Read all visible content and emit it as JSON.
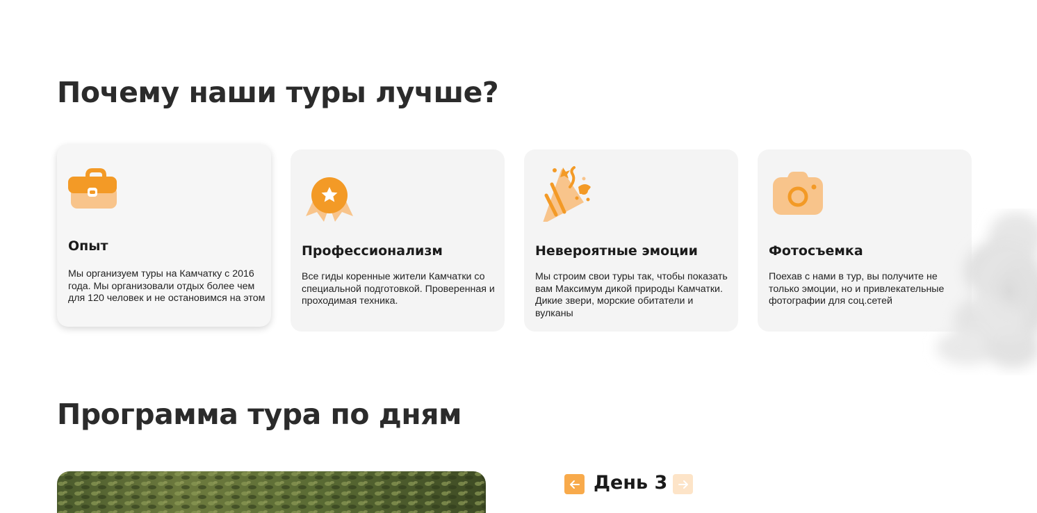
{
  "why_section": {
    "title": "Почему наши туры лучше?",
    "cards": [
      {
        "icon": "briefcase-icon",
        "title": "Опыт",
        "text": "Мы организуем туры на Камчатку с 2016 года. Мы организовали отдых более чем для 120 человек и не остановимся на этом"
      },
      {
        "icon": "medal-icon",
        "title": "Профессионализм",
        "text": "Все гиды коренные жители Камчатки со специальной подготовкой. Проверенная и проходимая техника."
      },
      {
        "icon": "party-popper-icon",
        "title": "Невероятные эмоции",
        "text": "Мы строим свои туры так, чтобы показать вам Максимум дикой природы Камчатки. Дикие звери, морские обитатели и вулканы"
      },
      {
        "icon": "camera-icon",
        "title": "Фотосъемка",
        "text": "Поехав с нами в тур, вы получите не только эмоции, но и привлекательные фотографии для соц.сетей"
      }
    ]
  },
  "program_section": {
    "title": "Программа тура по дням",
    "day_label": "День 3",
    "prev_icon": "arrow-left-icon",
    "next_icon": "arrow-right-icon"
  },
  "colors": {
    "accent": "#f39a26",
    "accent_light": "#f8c48b",
    "card_bg": "#f4f4f4",
    "heading": "#2b2b2b"
  }
}
